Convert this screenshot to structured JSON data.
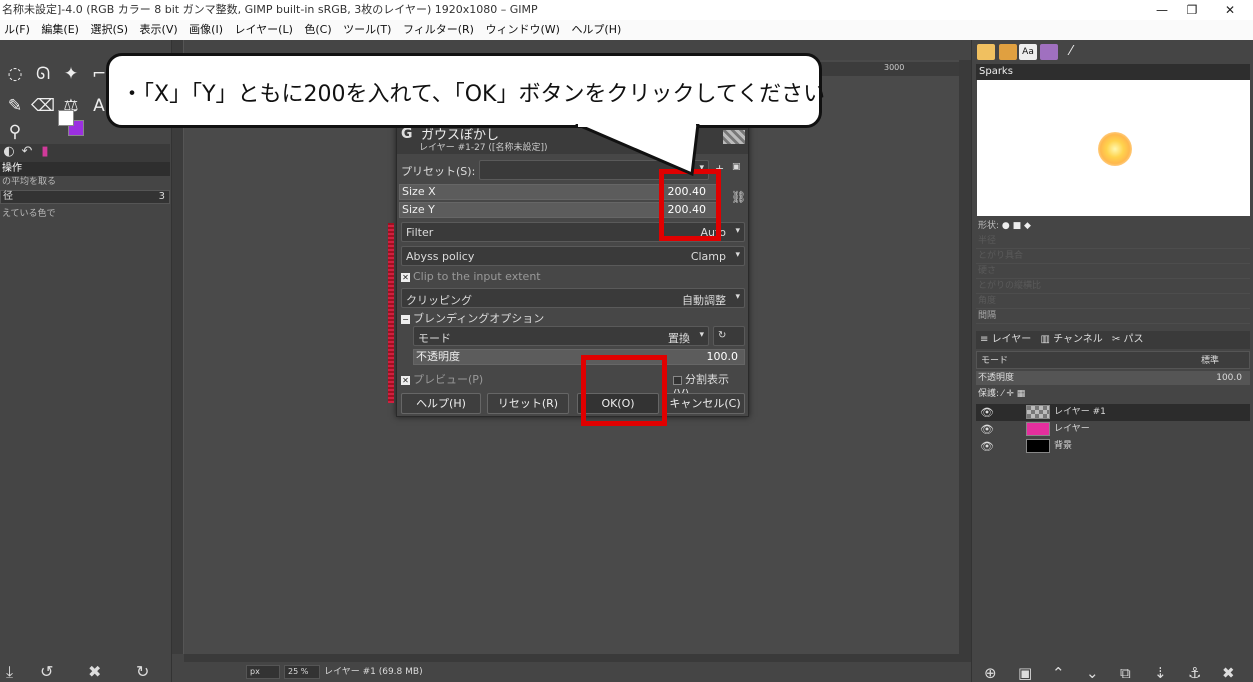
{
  "window": {
    "title": "名称未設定]-4.0 (RGB カラー 8 bit ガンマ整数, GIMP built-in sRGB, 3枚のレイヤー) 1920x1080 – GIMP",
    "minimize_glyph": "—",
    "restore_glyph": "❐",
    "close_glyph": "✕"
  },
  "menubar": [
    "ル(F)",
    "編集(E)",
    "選択(S)",
    "表示(V)",
    "画像(I)",
    "レイヤー(L)",
    "色(C)",
    "ツール(T)",
    "フィルター(R)",
    "ウィンドウ(W)",
    "ヘルプ(H)"
  ],
  "left_dock": {
    "panel_title": "操作",
    "sub1": "の平均を取る",
    "field_label": "径",
    "field_value": "3",
    "sub2": "えている色で",
    "fg_color": "#ffffff",
    "bg_color": "#9b2fe0"
  },
  "ruler": {
    "mark_3000": "3000"
  },
  "statusbar": {
    "unit": "px",
    "zoom": "25 %",
    "info": "レイヤー #1 (69.8 MB)"
  },
  "right_dock": {
    "brush_name": "Sparks",
    "shape_label": "形状:",
    "faded_rows": [
      "半径",
      "とがり具合",
      "硬さ",
      "とがりの縦横比",
      "角度",
      "間隔"
    ],
    "tabs": {
      "layers": "レイヤー",
      "channels": "チャンネル",
      "paths": "パス"
    },
    "mode_label": "モード",
    "mode_value": "標準",
    "opacity_label": "不透明度",
    "opacity_value": "100.0",
    "lock_label": "保護:",
    "layers": [
      {
        "name": "レイヤー #1",
        "thumb": "checker"
      },
      {
        "name": "レイヤー",
        "thumb": "#e52f9e"
      },
      {
        "name": "背景",
        "thumb": "#000000"
      }
    ]
  },
  "dialog": {
    "title": "ガウスぼかし",
    "subtitle": "レイヤー #1-27 ([名称未設定])",
    "preset_label": "プリセット(S):",
    "size_x_label": "Size X",
    "size_x_value": "200.40",
    "size_y_label": "Size Y",
    "size_y_value": "200.40",
    "filter_label": "Filter",
    "filter_value": "Auto",
    "abyss_label": "Abyss policy",
    "abyss_value": "Clamp",
    "clip_input_label": "Clip to the input extent",
    "clipping_label": "クリッピング",
    "clipping_value": "自動調整",
    "blend_label": "ブレンディングオプション",
    "mode_label": "モード",
    "mode_value": "置換",
    "opacity_label": "不透明度",
    "opacity_value": "100.0",
    "preview_label": "プレビュー(P)",
    "split_label": "分割表示(V)",
    "help_btn": "ヘルプ(H)",
    "reset_btn": "リセット(R)",
    "ok_btn": "OK(O)",
    "cancel_btn": "キャンセル(C)"
  },
  "annotation": {
    "callout": "・「X」「Y」ともに200を入れて、「OK」ボタンをクリックしてください",
    "highlight_color": "#e00000"
  }
}
